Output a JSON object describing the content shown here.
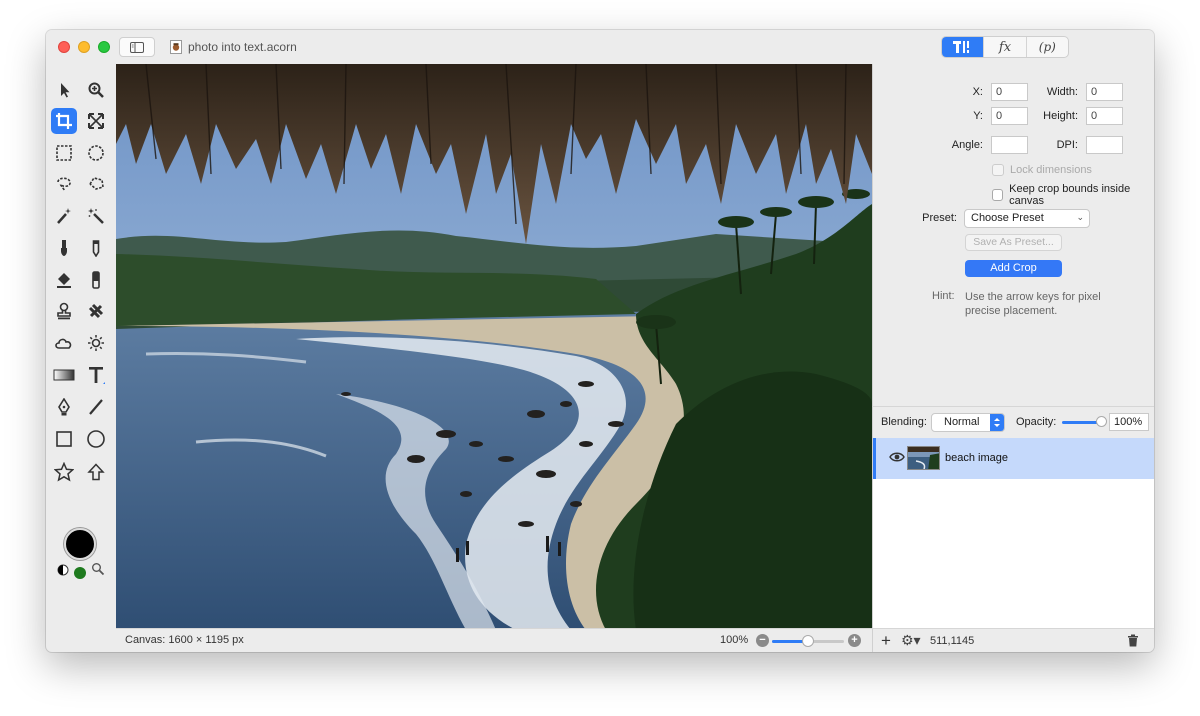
{
  "window": {
    "title": "photo into text.acorn"
  },
  "toolbar": {
    "segments": [
      {
        "name": "tools-inspector",
        "icon": "tool-settings-icon",
        "active": true
      },
      {
        "name": "effects",
        "label": "fx",
        "active": false
      },
      {
        "name": "properties",
        "label": "(p)",
        "active": false
      }
    ]
  },
  "tools": [
    {
      "name": "move-tool",
      "icon": "arrow-pointer-icon"
    },
    {
      "name": "zoom-tool",
      "icon": "magnifier-plus-icon"
    },
    {
      "name": "crop-tool",
      "icon": "crop-icon",
      "selected": true
    },
    {
      "name": "transform-tool",
      "icon": "expand-arrows-icon"
    },
    {
      "name": "rect-select-tool",
      "icon": "dashed-rect-icon"
    },
    {
      "name": "ellipse-select-tool",
      "icon": "dashed-circle-icon"
    },
    {
      "name": "lasso-tool",
      "icon": "lasso-icon"
    },
    {
      "name": "polygon-lasso-tool",
      "icon": "polygon-lasso-icon"
    },
    {
      "name": "magic-wand-tool",
      "icon": "magic-wand-icon"
    },
    {
      "name": "instant-alpha-tool",
      "icon": "magic-wand-sparkle-icon"
    },
    {
      "name": "brush-tool",
      "icon": "brush-icon"
    },
    {
      "name": "pencil-tool",
      "icon": "pencil-icon"
    },
    {
      "name": "paint-bucket-tool",
      "icon": "paint-bucket-icon"
    },
    {
      "name": "eraser-tool",
      "icon": "eraser-icon"
    },
    {
      "name": "clone-tool",
      "icon": "stamp-icon"
    },
    {
      "name": "heal-tool",
      "icon": "bandage-icon"
    },
    {
      "name": "burn-tool",
      "icon": "cloud-icon"
    },
    {
      "name": "dodge-tool",
      "icon": "sun-icon"
    },
    {
      "name": "gradient-tool",
      "icon": "gradient-icon"
    },
    {
      "name": "text-tool",
      "icon": "text-t-icon"
    },
    {
      "name": "pen-tool",
      "icon": "pen-nib-icon"
    },
    {
      "name": "line-tool",
      "icon": "line-icon"
    },
    {
      "name": "rect-shape-tool",
      "icon": "square-icon"
    },
    {
      "name": "oval-shape-tool",
      "icon": "circle-icon"
    },
    {
      "name": "star-shape-tool",
      "icon": "star-icon"
    },
    {
      "name": "arrow-shape-tool",
      "icon": "up-arrow-icon"
    }
  ],
  "colors": {
    "accent": "#2f7cf6",
    "foreground_color": "#000000",
    "background_swatch": "#1e7a1e"
  },
  "inspector": {
    "x_label": "X:",
    "x_value": "0",
    "y_label": "Y:",
    "y_value": "0",
    "width_label": "Width:",
    "width_value": "0",
    "height_label": "Height:",
    "height_value": "0",
    "angle_label": "Angle:",
    "angle_value": "",
    "dpi_label": "DPI:",
    "dpi_value": "",
    "lock_dimensions": "Lock dimensions",
    "keep_bounds": "Keep crop bounds inside canvas",
    "preset_label": "Preset:",
    "preset_value": "Choose Preset",
    "save_preset": "Save As Preset...",
    "add_crop": "Add Crop",
    "hint_label": "Hint:",
    "hint_text": "Use the arrow keys for pixel precise placement."
  },
  "layers": {
    "blending_label": "Blending:",
    "blending_value": "Normal",
    "opacity_label": "Opacity:",
    "opacity_value": "100%",
    "opacity_fraction": 1.0,
    "items": [
      {
        "name": "beach image",
        "visible": true,
        "selected": true
      }
    ]
  },
  "status": {
    "canvas_info": "Canvas: 1600 × 1195 px",
    "zoom_label": "100%",
    "zoom_slider_fraction": 0.5,
    "coordinates": "511,1145"
  }
}
